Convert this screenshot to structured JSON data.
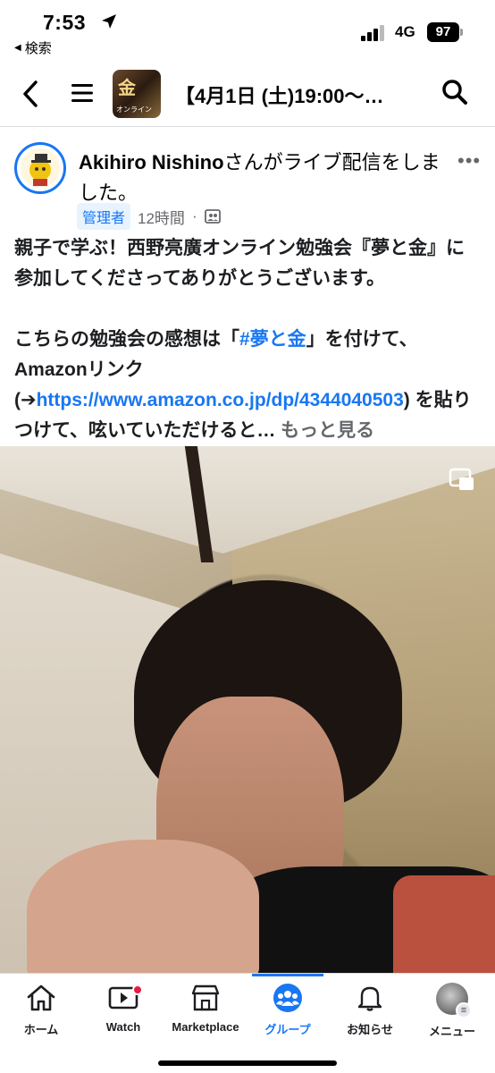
{
  "status_bar": {
    "time": "7:53",
    "back_app": "検索",
    "network": "4G",
    "battery": "97"
  },
  "nav": {
    "title": "【4月1日 (土)19:00〜…",
    "thumb_main": "金",
    "thumb_sub": "オンライン"
  },
  "post": {
    "author": "Akihiro Nishino",
    "action": "さんがライブ配信をしました。",
    "badge": "管理者",
    "time": "12時間",
    "separator": "·",
    "line1": "親子で学ぶ！西野亮廣オンライン勉強会『夢と金』に参加してくださってありがとうございます。",
    "line2_a": "こちらの勉強会の感想は「",
    "hashtag": "#夢と金",
    "line2_b": "」を付けて、Amazonリンク (➔",
    "url": "https://www.amazon.co.jp/dp/4344040503",
    "line2_c": ") を貼りつけて、呟いていただけると… ",
    "see_more": "もっと見る"
  },
  "tabs": [
    {
      "label": "ホーム",
      "icon": "home-icon"
    },
    {
      "label": "Watch",
      "icon": "watch-icon"
    },
    {
      "label": "Marketplace",
      "icon": "marketplace-icon"
    },
    {
      "label": "グループ",
      "icon": "groups-icon"
    },
    {
      "label": "お知らせ",
      "icon": "bell-icon"
    },
    {
      "label": "メニュー",
      "icon": "menu-avatar"
    }
  ],
  "colors": {
    "accent": "#1877f2",
    "notification": "#e41e3f",
    "secondary_text": "#65676b"
  }
}
